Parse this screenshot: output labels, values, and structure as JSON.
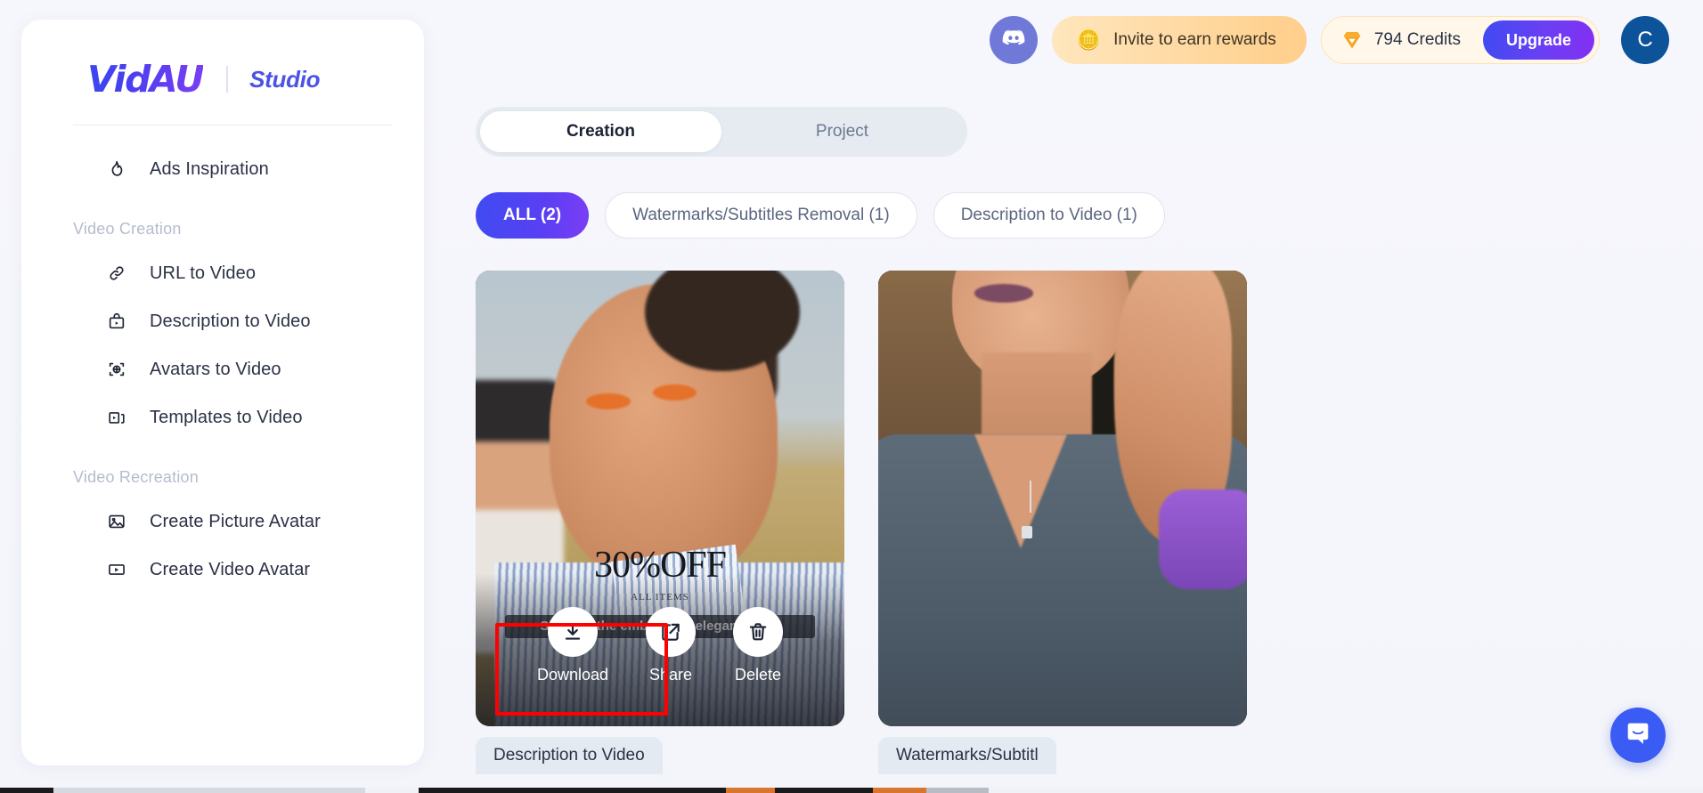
{
  "brand": {
    "logo": "VidAU",
    "subtitle": "Studio"
  },
  "sidebar": {
    "items": [
      {
        "label": "Ads Inspiration",
        "icon": "flame-icon",
        "type": "item"
      },
      {
        "label": "Video Creation",
        "type": "group"
      },
      {
        "label": "URL to Video",
        "icon": "link-icon",
        "type": "item"
      },
      {
        "label": "Description to Video",
        "icon": "bag-play-icon",
        "type": "item"
      },
      {
        "label": "Avatars to Video",
        "icon": "target-avatar-icon",
        "type": "item"
      },
      {
        "label": "Templates to Video",
        "icon": "templates-icon",
        "type": "item"
      },
      {
        "label": "Video Recreation",
        "type": "group"
      },
      {
        "label": "Create Picture Avatar",
        "icon": "image-icon",
        "type": "item"
      },
      {
        "label": "Create Video Avatar",
        "icon": "video-icon",
        "type": "item"
      }
    ]
  },
  "header": {
    "discord_icon": "discord-icon",
    "invite_emoji": "🪙",
    "invite_label": "Invite to earn rewards",
    "credits_label": "794 Credits",
    "gem_icon": "gem-icon",
    "upgrade_label": "Upgrade",
    "avatar_initial": "C"
  },
  "main": {
    "tabs": [
      {
        "label": "Creation",
        "active": true
      },
      {
        "label": "Project",
        "active": false
      }
    ],
    "filters": [
      {
        "label": "ALL (2)",
        "active": true
      },
      {
        "label": "Watermarks/Subtitles Removal (1)",
        "active": false
      },
      {
        "label": "Description to Video (1)",
        "active": false
      }
    ],
    "cards": [
      {
        "tag": "Description to Video",
        "overlay_headline": "30%OFF",
        "overlay_subtext": "ALL ITEMS",
        "overlay_caption": "Slip into the embrace of elegance and",
        "actions": [
          {
            "label": "Download",
            "icon": "download-icon"
          },
          {
            "label": "Share",
            "icon": "share-icon"
          },
          {
            "label": "Delete",
            "icon": "trash-icon"
          }
        ]
      },
      {
        "tag": "Watermarks/Subtitl",
        "overlay_headline": "",
        "overlay_subtext": "",
        "overlay_caption": "",
        "actions": []
      }
    ]
  },
  "chat": {
    "icon": "chat-bubble-icon"
  },
  "colors": {
    "brand_blue": "#3f4bf2",
    "brand_purple": "#7b3ef4",
    "credit_gold": "#f5a623",
    "annotation_red": "#ff0000",
    "avatar_blue": "#0d5399",
    "chat_blue": "#3a5cf5"
  }
}
